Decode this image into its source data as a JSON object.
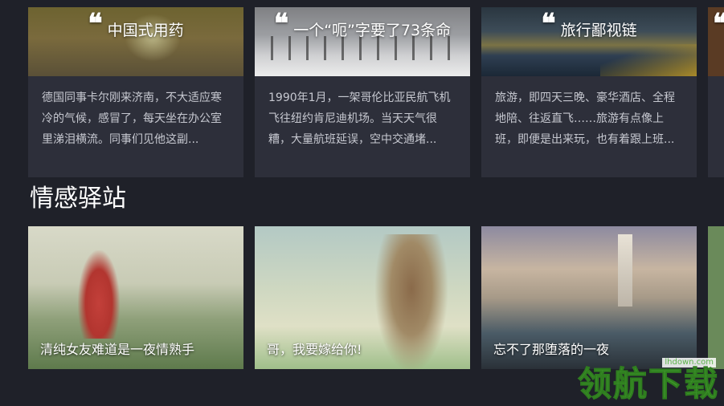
{
  "top_cards": [
    {
      "title": "中国式用药",
      "excerpt": "德国同事卡尔刚来济南，不大适应寒冷的气候，感冒了，每天坐在办公室里涕泪横流。同事们见他这副..."
    },
    {
      "title": "一个“呃”字要了73条命",
      "excerpt": "1990年1月，一架哥伦比亚民航飞机飞往纽约肯尼迪机场。当天天气很糟，大量航班延误，空中交通堵..."
    },
    {
      "title": "旅行鄙视链",
      "excerpt": "旅游，即四天三晚、豪华酒店、全程地陪、往返直飞……旅游有点像上班，即便是出来玩，也有着跟上班..."
    }
  ],
  "section": {
    "title": "情感驿站"
  },
  "bottom_cards": [
    {
      "caption": "清纯女友难道是一夜情熟手"
    },
    {
      "caption": "哥，我要嫁给你!"
    },
    {
      "caption": "忘不了那堕落的一夜"
    }
  ],
  "watermark": {
    "url": "lhdown.com",
    "text": "领航下载"
  },
  "icons": {
    "quote": "quote-icon"
  },
  "quote_glyph": "❝"
}
